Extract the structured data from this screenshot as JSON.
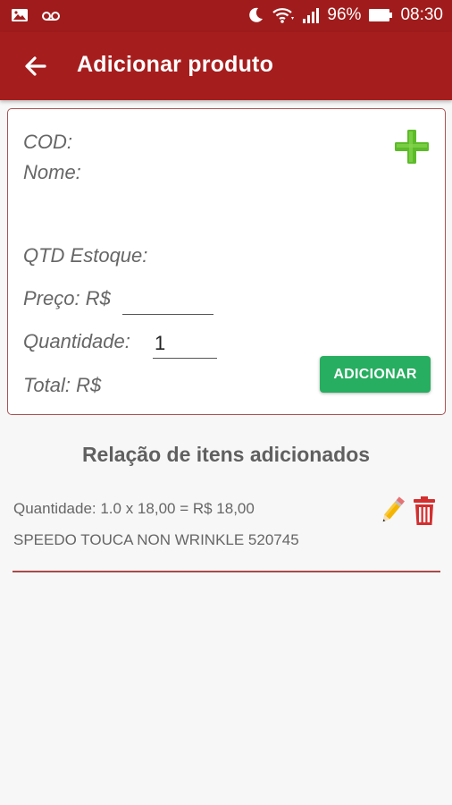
{
  "status_bar": {
    "battery": "96%",
    "time": "08:30"
  },
  "app_bar": {
    "title": "Adicionar produto"
  },
  "form": {
    "cod_label": "COD:",
    "nome_label": "Nome:",
    "estoque_label": "QTD Estoque:",
    "preco_label": "Preço: R$",
    "preco_value": "",
    "quantidade_label": "Quantidade:",
    "quantidade_value": "1",
    "total_label": "Total: R$",
    "add_button": "ADICIONAR"
  },
  "list": {
    "title": "Relação de itens adicionados",
    "items": [
      {
        "quantity_line": "Quantidade: 1.0 x 18,00 = R$ 18,00",
        "product_name": "SPEEDO TOUCA NON WRINKLE 520745"
      }
    ]
  },
  "colors": {
    "primary": "#a61d1d",
    "accent_green": "#27ae60",
    "plus_green": "#5dbb2a",
    "edit_yellow": "#f4b400",
    "delete_red": "#d32f2f"
  }
}
